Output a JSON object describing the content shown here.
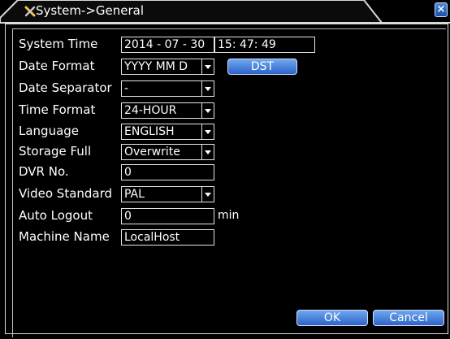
{
  "window": {
    "title": "System->General",
    "close_glyph": "×"
  },
  "form": {
    "system_time": {
      "label": "System Time",
      "date": "2014 - 07 - 30",
      "time": "15: 47: 49"
    },
    "date_format": {
      "label": "Date Format",
      "value": "YYYY MM D"
    },
    "dst_button": "DST",
    "date_separator": {
      "label": "Date Separator",
      "value": "-"
    },
    "time_format": {
      "label": "Time Format",
      "value": "24-HOUR"
    },
    "language": {
      "label": "Language",
      "value": "ENGLISH"
    },
    "storage_full": {
      "label": "Storage Full",
      "value": "Overwrite"
    },
    "dvr_no": {
      "label": "DVR No.",
      "value": "0"
    },
    "video_standard": {
      "label": "Video Standard",
      "value": "PAL"
    },
    "auto_logout": {
      "label": "Auto Logout",
      "value": "0",
      "unit": "min"
    },
    "machine_name": {
      "label": "Machine Name",
      "value": "LocalHost"
    }
  },
  "buttons": {
    "ok": "OK",
    "cancel": "Cancel"
  },
  "icons": {
    "title": "tools-icon",
    "close": "close-icon",
    "dropdown": "chevron-down-icon"
  }
}
